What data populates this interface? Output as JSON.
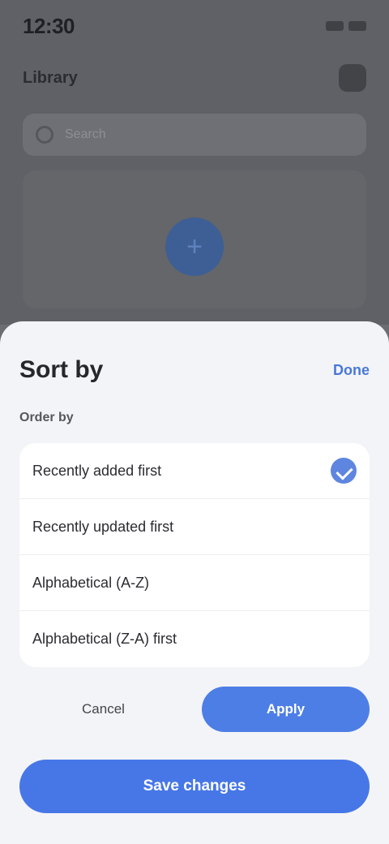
{
  "status_bar": {
    "time": "12:30"
  },
  "background": {
    "title": "Library",
    "search_placeholder": "Search",
    "fab_icon": "plus-icon"
  },
  "sheet": {
    "title": "Sort by",
    "action_label": "Done",
    "section_label": "Order by",
    "options": [
      {
        "label": "Recently added first",
        "selected": true
      },
      {
        "label": "Recently updated first",
        "selected": false
      },
      {
        "label": "Alphabetical (A-Z)",
        "selected": false
      },
      {
        "label": "Alphabetical (Z-A) first",
        "selected": false
      }
    ],
    "secondary_button": "Cancel",
    "primary_button": "Apply",
    "main_button": "Save changes"
  },
  "colors": {
    "accent": "#4d7ee6",
    "sheet_background": "#f3f4f7",
    "scrim": "#5f6166"
  }
}
